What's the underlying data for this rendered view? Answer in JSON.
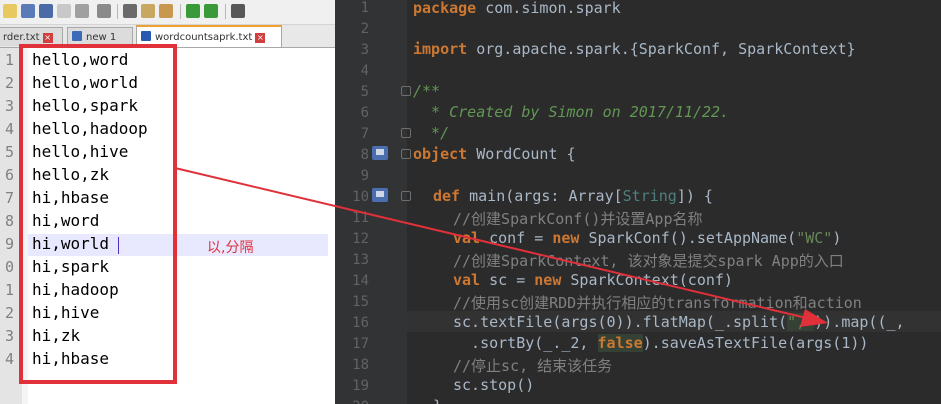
{
  "npp": {
    "tabs": [
      {
        "label": "rder.txt"
      },
      {
        "label": "new 1"
      },
      {
        "label": "wordcountsaprk.txt"
      }
    ],
    "line_numbers": [
      "1",
      "2",
      "3",
      "4",
      "5",
      "6",
      "7",
      "8",
      "9",
      "0",
      "1",
      "2",
      "3",
      "4"
    ],
    "lines": [
      "hello,word",
      "hello,world",
      "hello,spark",
      "hello,hadoop",
      "hello,hive",
      "hello,zk",
      "hi,hbase",
      "hi,word",
      "hi,world",
      "hi,spark",
      "hi,hadoop",
      "hi,hive",
      "hi,zk",
      "hi,hbase"
    ],
    "annotation": "以,分隔"
  },
  "ide": {
    "line_numbers": [
      "1",
      "2",
      "3",
      "4",
      "5",
      "6",
      "7",
      "8",
      "9",
      "10",
      "11",
      "12",
      "13",
      "14",
      "15",
      "16",
      "17",
      "18",
      "19",
      "20"
    ],
    "code": {
      "l1_kw": "package",
      "l1_rest": " com.simon.spark",
      "l3_kw": "import",
      "l3_rest": " org.apache.spark.{SparkConf, SparkContext}",
      "l5": "/**",
      "l6": "  * Created by Simon on 2017/11/22.",
      "l7": "  */",
      "l8_kw": "object",
      "l8_rest": " WordCount {",
      "l10_kw": "def",
      "l10_a": " main(args: Array[",
      "l10_ty": "String",
      "l10_b": "]) {",
      "l11": "//创建SparkConf()并设置App名称",
      "l12_kw": "val",
      "l12_a": " conf = ",
      "l12_kw2": "new",
      "l12_b": " SparkConf().setAppName(",
      "l12_str": "\"WC\"",
      "l12_c": ")",
      "l13": "//创建SparkContext, 该对象是提交spark App的入口",
      "l14_kw": "val",
      "l14_a": " sc = ",
      "l14_kw2": "new",
      "l14_b": " SparkContext(conf)",
      "l15": "//使用sc创建RDD并执行相应的transformation和action",
      "l16_a": "sc.textFile(args(0)).flatMap(_.split(",
      "l16_str": "\",\"",
      "l16_b": ")).map((_,",
      "l17_a": "  .sortBy(_._2, ",
      "l17_kw": "false",
      "l17_b": ").saveAsTextFile(args(1))",
      "l18": "//停止sc, 结束该任务",
      "l19": "sc.stop()",
      "l20": "}"
    }
  },
  "colors": {
    "annotation_red": "#e0303a",
    "ide_bg": "#2b2b2b",
    "keyword": "#cc7832"
  }
}
